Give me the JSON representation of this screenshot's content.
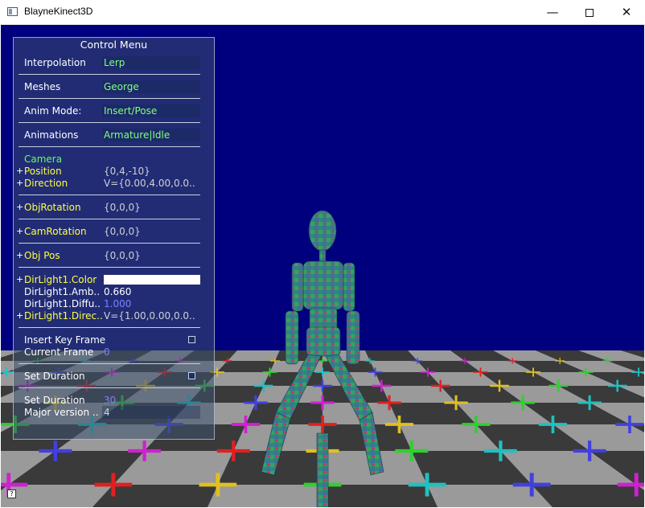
{
  "window": {
    "title": "BlayneKinect3D",
    "minimize_glyph": "—",
    "close_glyph": "✕"
  },
  "panel": {
    "title": "Control Menu",
    "rows": {
      "interpolation": {
        "label": "Interpolation",
        "value": "Lerp"
      },
      "meshes": {
        "label": "Meshes",
        "value": "George"
      },
      "anim_mode": {
        "label": "Anim Mode:",
        "value": "Insert/Pose"
      },
      "animations": {
        "label": "Animations",
        "value": "Armature|Idle"
      },
      "camera": {
        "label": "Camera"
      },
      "position": {
        "label": "Position",
        "value": "{0,4,-10}"
      },
      "direction": {
        "label": "Direction",
        "value": "V={0.00,4.00,0.0.."
      },
      "obj_rotation": {
        "label": "ObjRotation",
        "value": "{0,0,0}"
      },
      "cam_rotation": {
        "label": "CamRotation",
        "value": "{0,0,0}"
      },
      "obj_pos": {
        "label": "Obj Pos",
        "value": "{0,0,0}"
      },
      "dirlight_color": {
        "label": "DirLight1.Color",
        "color": "#ffffff"
      },
      "dirlight_ambient": {
        "label": "DirLight1.Amb..",
        "value": "0.660"
      },
      "dirlight_diffuse": {
        "label": "DirLight1.Diffu..",
        "value": "1.000"
      },
      "dirlight_direction": {
        "label": "DirLight1.Direc..",
        "value": "V={1.00,0.00,0.0.."
      },
      "insert_key_frame": {
        "label": "Insert Key Frame",
        "checked": false
      },
      "current_frame": {
        "label": "Current Frame",
        "value": "0"
      },
      "set_duration_toggle": {
        "label": "Set Duration",
        "checked": false
      },
      "set_duration": {
        "label": "Set Duration",
        "value": "30"
      },
      "major_version": {
        "label": "Major version ..",
        "value": "4"
      }
    },
    "expand_glyph": "+"
  },
  "scene": {
    "background": "#00007f",
    "floor_colors": [
      "#3a3a3a",
      "#9a9a9a"
    ],
    "cross_colors": [
      "#d020d0",
      "#e02020",
      "#e0c020",
      "#30d030",
      "#20c0c0",
      "#4040e0"
    ]
  },
  "status_icon": "?"
}
